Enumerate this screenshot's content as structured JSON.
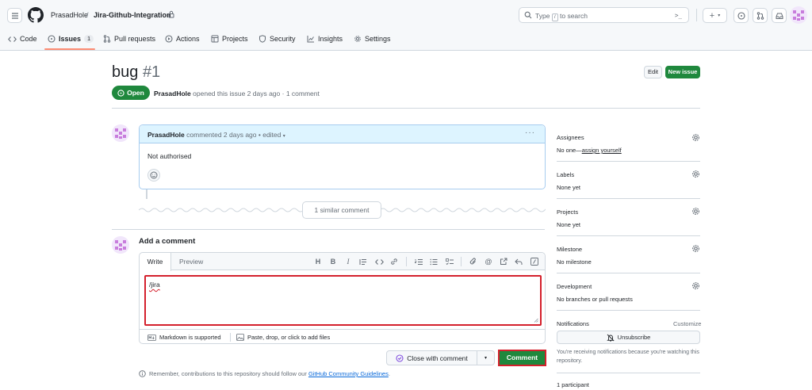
{
  "header": {
    "owner": "PrasadHole",
    "separator": "/",
    "repo": "Jira-Github-Integration",
    "search_prefix": "Type",
    "search_key": "/",
    "search_suffix": "to search",
    "terminal_glyph": ">_",
    "plus_glyph": "+",
    "caret_glyph": "▾"
  },
  "tabs": [
    {
      "label": "Code",
      "icon": "code-icon"
    },
    {
      "label": "Issues",
      "icon": "issue-opened-icon",
      "count": "1",
      "active": true
    },
    {
      "label": "Pull requests",
      "icon": "git-pull-request-icon"
    },
    {
      "label": "Actions",
      "icon": "play-icon"
    },
    {
      "label": "Projects",
      "icon": "table-icon"
    },
    {
      "label": "Security",
      "icon": "shield-icon"
    },
    {
      "label": "Insights",
      "icon": "graph-icon"
    },
    {
      "label": "Settings",
      "icon": "gear-icon"
    }
  ],
  "issue": {
    "title": "bug",
    "number": "#1",
    "state": "Open",
    "author": "PrasadHole",
    "meta": "opened this issue 2 days ago · 1 comment",
    "edit_label": "Edit",
    "new_label": "New issue"
  },
  "comment": {
    "author": "PrasadHole",
    "meta": "commented 2 days ago • edited",
    "body": "Not authorised",
    "menu_glyph": "···",
    "similar_label": "1 similar comment"
  },
  "composer": {
    "heading": "Add a comment",
    "tab_write": "Write",
    "tab_preview": "Preview",
    "value": "/jira",
    "markdown_note": "Markdown is supported",
    "attach_note": "Paste, drop, or click to add files",
    "close_label": "Close with comment",
    "submit_label": "Comment",
    "remember_prefix": "Remember, contributions to this repository should follow our",
    "remember_link": "GitHub Community Guidelines",
    "remember_suffix": "."
  },
  "sidebar": {
    "assignees_label": "Assignees",
    "assignees_prefix": "No one—",
    "assignees_link": "assign yourself",
    "labels_label": "Labels",
    "labels_value": "None yet",
    "projects_label": "Projects",
    "projects_value": "None yet",
    "milestone_label": "Milestone",
    "milestone_value": "No milestone",
    "development_label": "Development",
    "development_value": "No branches or pull requests",
    "notifications_label": "Notifications",
    "customize_label": "Customize",
    "unsubscribe_label": "Unsubscribe",
    "notifications_note": "You're receiving notifications because you're watching this repository.",
    "participants_label": "1 participant"
  },
  "colors": {
    "accent_green": "#1f883d",
    "highlight_red": "#d4202c",
    "link_blue": "#0969da",
    "tab_underline": "#fd8c73",
    "comment_header_bg": "#ddf4ff"
  }
}
